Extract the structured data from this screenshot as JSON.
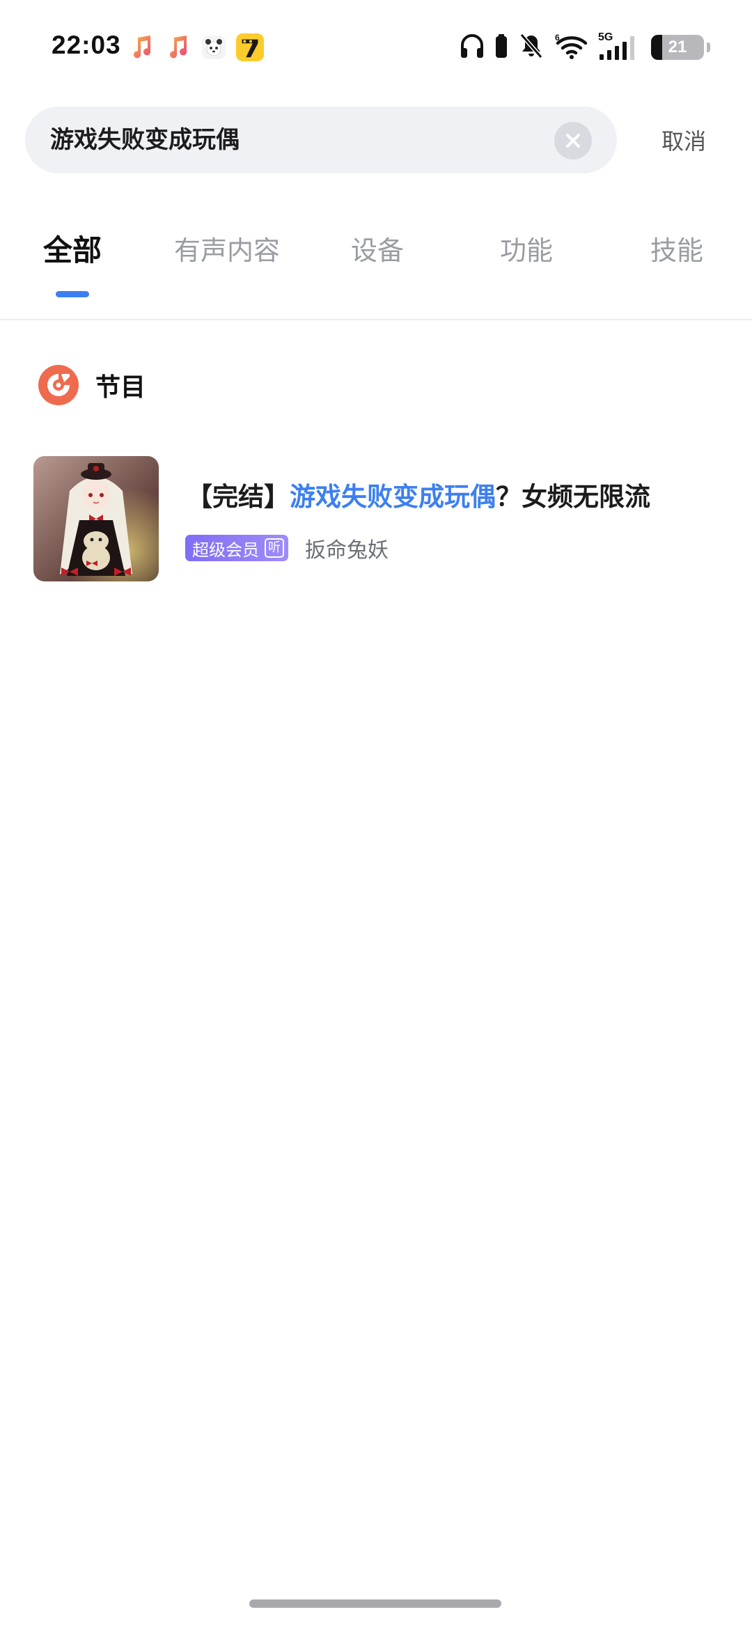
{
  "status_bar": {
    "time": "22:03",
    "notification_icons": [
      "music-note-icon",
      "music-note-icon",
      "panda-app-icon",
      "qimao-app-icon"
    ],
    "system_icons": [
      "headphones-icon",
      "headphone-battery-icon",
      "bell-muted-icon",
      "wifi-icon",
      "5g-signal-icon"
    ],
    "signal_label": "5G",
    "battery_level": "21",
    "battery_fraction": 0.21
  },
  "search": {
    "query": "游戏失败变成玩偶",
    "cancel_label": "取消"
  },
  "tabs": [
    {
      "label": "全部",
      "active": true
    },
    {
      "label": "有声内容",
      "active": false
    },
    {
      "label": "设备",
      "active": false
    },
    {
      "label": "功能",
      "active": false
    },
    {
      "label": "技能",
      "active": false
    }
  ],
  "section": {
    "title": "节目",
    "icon": "album-disc-icon"
  },
  "results": [
    {
      "title_prefix": "【完结】",
      "title_highlight": "游戏失败变成玩偶",
      "title_suffix": "？女频无限流",
      "badge_label": "超级会员",
      "badge_listen": "听",
      "author": "扳命兔妖",
      "cover": "anime-girl-cover-image"
    }
  ],
  "colors": {
    "accent": "#3d7ff0",
    "section_icon": "#ef6b4e",
    "vip_badge": "#8b7cf7",
    "search_bg": "#f0f1f5"
  }
}
